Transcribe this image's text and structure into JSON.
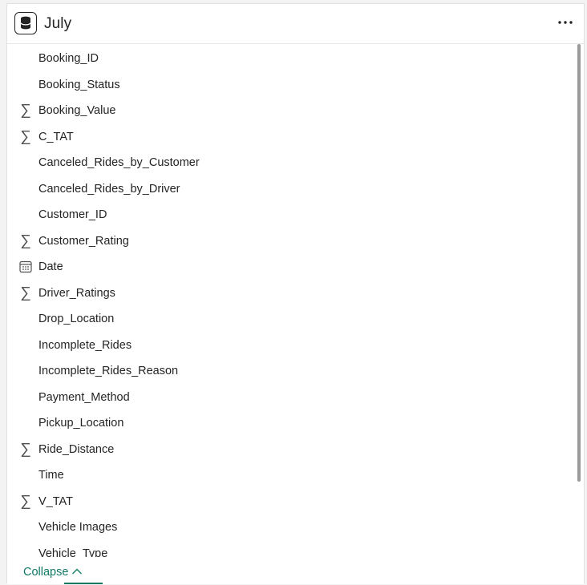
{
  "header": {
    "title": "July",
    "table_icon": "database-table-icon",
    "more_icon": "more-options-icon"
  },
  "fields": [
    {
      "name": "Booking_ID",
      "icon": "none"
    },
    {
      "name": "Booking_Status",
      "icon": "none"
    },
    {
      "name": "Booking_Value",
      "icon": "sigma"
    },
    {
      "name": "C_TAT",
      "icon": "sigma"
    },
    {
      "name": "Canceled_Rides_by_Customer",
      "icon": "none"
    },
    {
      "name": "Canceled_Rides_by_Driver",
      "icon": "none"
    },
    {
      "name": "Customer_ID",
      "icon": "none"
    },
    {
      "name": "Customer_Rating",
      "icon": "sigma"
    },
    {
      "name": "Date",
      "icon": "calendar"
    },
    {
      "name": "Driver_Ratings",
      "icon": "sigma"
    },
    {
      "name": "Drop_Location",
      "icon": "none"
    },
    {
      "name": "Incomplete_Rides",
      "icon": "none"
    },
    {
      "name": "Incomplete_Rides_Reason",
      "icon": "none"
    },
    {
      "name": "Payment_Method",
      "icon": "none"
    },
    {
      "name": "Pickup_Location",
      "icon": "none"
    },
    {
      "name": "Ride_Distance",
      "icon": "sigma"
    },
    {
      "name": "Time",
      "icon": "none"
    },
    {
      "name": "V_TAT",
      "icon": "sigma"
    },
    {
      "name": "Vehicle Images",
      "icon": "none"
    },
    {
      "name": "Vehicle_Type",
      "icon": "none"
    }
  ],
  "footer": {
    "collapse_label": "Collapse",
    "collapse_icon": "chevron-up-icon"
  },
  "colors": {
    "accent": "#117865",
    "text": "#242424",
    "icon": "#505050"
  }
}
